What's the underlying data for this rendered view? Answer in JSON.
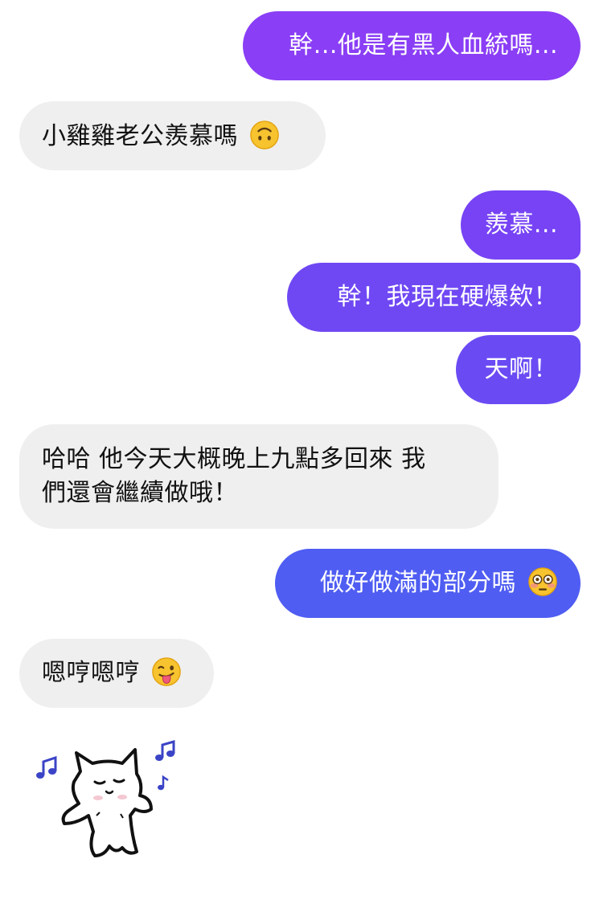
{
  "messages": [
    {
      "side": "out",
      "text": "幹...他是有黑人血統嗎..."
    },
    {
      "side": "in",
      "text": "小雞雞老公羨慕嗎",
      "emoji": "upside-down-face-emoji"
    },
    {
      "side": "out",
      "text": "羨慕..."
    },
    {
      "side": "out",
      "text": "幹！我現在硬爆欸！"
    },
    {
      "side": "out",
      "text": "天啊！"
    },
    {
      "side": "in",
      "line1": "哈哈 他今天大概晚上九點多回來 我",
      "line2": "們還會繼續做哦！"
    },
    {
      "side": "out",
      "text": "做好做滿的部分嗎",
      "emoji": "flushed-face-emoji"
    },
    {
      "side": "in",
      "text": "嗯哼嗯哼",
      "emoji": "winking-tongue-face-emoji"
    }
  ],
  "sticker": {
    "name": "dancing-cat-sticker"
  },
  "colors": {
    "out_top": "#8b3cf5",
    "out_mid": "#6f48f3",
    "out_bottom": "#4f5df2",
    "in_bg": "#efefef"
  }
}
